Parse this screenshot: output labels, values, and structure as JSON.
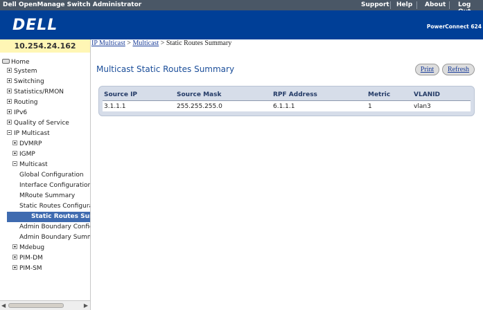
{
  "topbar": {
    "title": "Dell OpenManage Switch Administrator",
    "menu": [
      "Support",
      "Help",
      "About",
      "Log Out"
    ]
  },
  "header": {
    "logo": "DELL",
    "product": "PowerConnect 624"
  },
  "left": {
    "ip": "10.254.24.162",
    "tree": [
      {
        "label": "Home",
        "kind": "home"
      },
      {
        "label": "System",
        "kind": "plus"
      },
      {
        "label": "Switching",
        "kind": "plus"
      },
      {
        "label": "Statistics/RMON",
        "kind": "plus"
      },
      {
        "label": "Routing",
        "kind": "plus"
      },
      {
        "label": "IPv6",
        "kind": "plus"
      },
      {
        "label": "Quality of Service",
        "kind": "plus"
      },
      {
        "label": "IP Multicast",
        "kind": "minus"
      },
      {
        "label": "DVMRP",
        "kind": "plus"
      },
      {
        "label": "IGMP",
        "kind": "plus"
      },
      {
        "label": "Multicast",
        "kind": "minus"
      },
      {
        "label": "Global Configuration",
        "kind": "leaf"
      },
      {
        "label": "Interface Configuration",
        "kind": "leaf"
      },
      {
        "label": "MRoute Summary",
        "kind": "leaf"
      },
      {
        "label": "Static Routes Configuration",
        "kind": "leaf"
      },
      {
        "label": "Static Routes Summary",
        "kind": "leaf",
        "selected": true
      },
      {
        "label": "Admin Boundary Configuration",
        "kind": "leaf"
      },
      {
        "label": "Admin Boundary Summary",
        "kind": "leaf"
      },
      {
        "label": "Mdebug",
        "kind": "plus"
      },
      {
        "label": "PIM-DM",
        "kind": "plus"
      },
      {
        "label": "PIM-SM",
        "kind": "plus"
      }
    ]
  },
  "breadcrumb": {
    "link1": "IP Multicast",
    "sep1": " > ",
    "link2": "Multicast",
    "sep2": " > ",
    "current": "Static Routes Summary"
  },
  "main": {
    "title": "Multicast Static Routes Summary",
    "print_label": "Print",
    "refresh_label": "Refresh",
    "table": {
      "columns": [
        "Source IP",
        "Source Mask",
        "RPF Address",
        "Metric",
        "VLANID"
      ],
      "rows": [
        [
          "3.1.1.1",
          "255.255.255.0",
          "6.1.1.1",
          "1",
          "vlan3"
        ]
      ]
    }
  }
}
